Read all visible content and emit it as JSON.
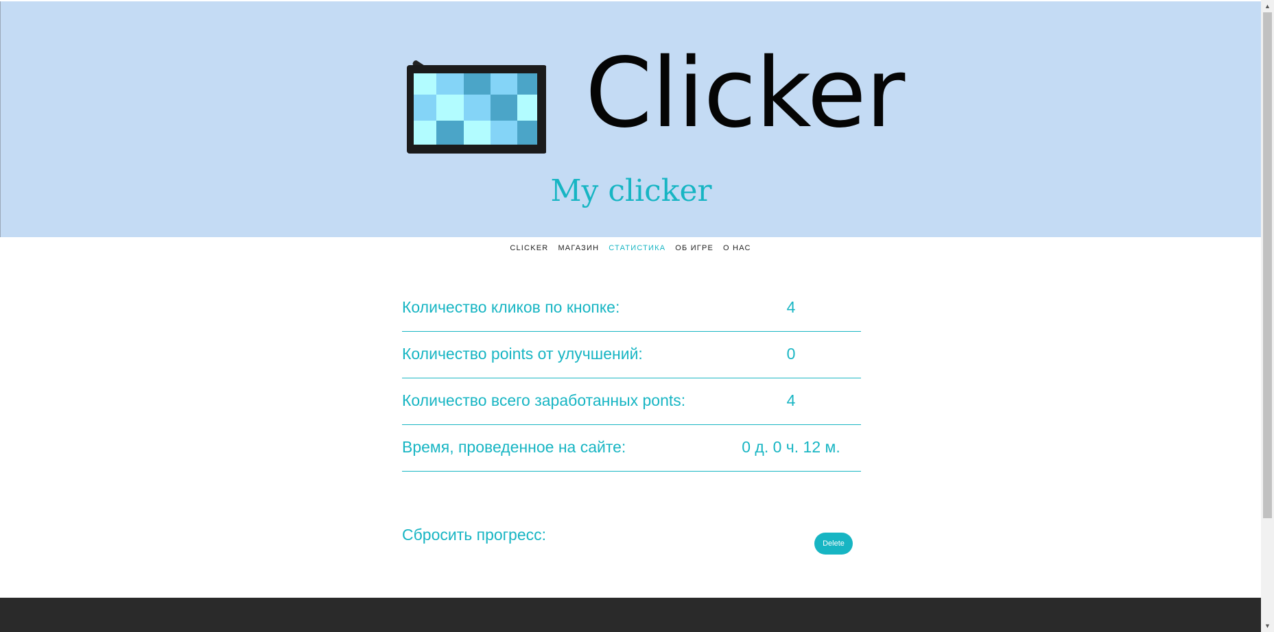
{
  "header": {
    "logo_text": "Clicker",
    "subtitle": "My clicker"
  },
  "nav": {
    "items": [
      {
        "label": "CLICKER"
      },
      {
        "label": "МАГАЗИН"
      },
      {
        "label": "СТАТИСТИКА"
      },
      {
        "label": "ОБ ИГРЕ"
      },
      {
        "label": "О НАС"
      }
    ],
    "active": "СТАТИСТИКА"
  },
  "stats": {
    "rows": [
      {
        "label": "Количество кликов по кнопке:",
        "value": "4"
      },
      {
        "label": "Количество points от улучшений:",
        "value": "0"
      },
      {
        "label": "Количество всего заработанных ponts:",
        "value": "4"
      },
      {
        "label": "Время, проведенное на сайте:",
        "value": "0 д. 0 ч. 12 м."
      }
    ]
  },
  "reset": {
    "label": "Сбросить прогресс:",
    "button_label": "Delete"
  },
  "colors": {
    "accent": "#17b5c3",
    "header_bg": "#c4dbf4",
    "footer_bg": "#2a2a2a"
  },
  "icons": {
    "logo": "tablet-grid-icon",
    "scroll_up": "arrow-up-icon",
    "scroll_down": "arrow-down-icon"
  }
}
